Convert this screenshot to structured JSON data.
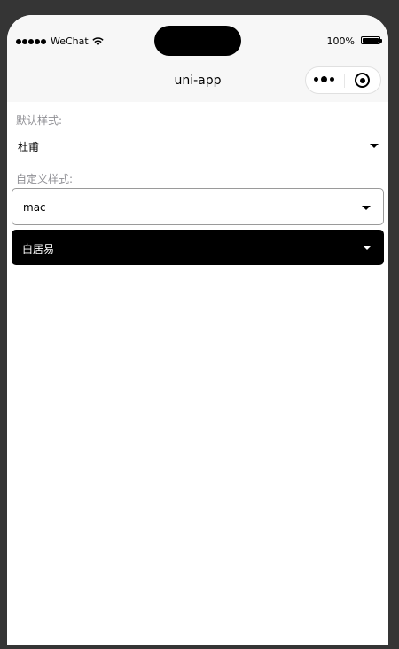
{
  "status_bar": {
    "carrier": "WeChat",
    "battery_percent": "100%"
  },
  "nav": {
    "title": "uni-app"
  },
  "sections": {
    "default_label": "默认样式:",
    "default_value": "杜甫",
    "custom_label": "自定义样式:",
    "custom_value_1": "mac",
    "custom_value_2": "白居易"
  },
  "icons": {
    "signal": "signal-dots-icon",
    "wifi": "wifi-icon",
    "battery": "battery-icon",
    "more": "more-icon",
    "close": "close-icon",
    "caret": "chevron-down-icon"
  },
  "colors": {
    "label_gray": "#8f8f94",
    "dark_select_bg": "#000000",
    "dark_select_text": "#ffffff"
  }
}
